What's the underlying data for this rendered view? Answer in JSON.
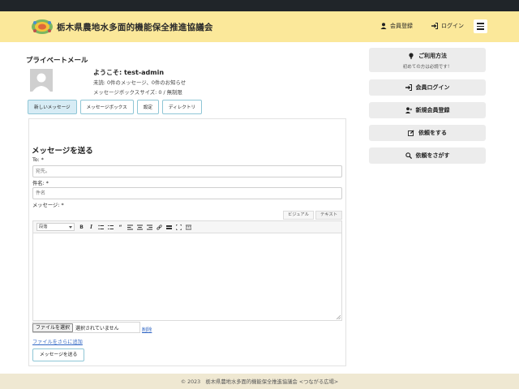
{
  "header": {
    "site_title": "栃木県農地水多面的機能保全推進協議会",
    "register_label": "会員登録",
    "login_label": "ログイン"
  },
  "main": {
    "page_heading": "プライベートメール",
    "welcome": "ようこそ: test-admin",
    "unread_info": "未読: 0件のメッセージ、0件のお知らせ",
    "box_size": "メッセージボックスサイズ: 0 / 無制限",
    "tabs": [
      {
        "label": "新しいメッセージ",
        "active": true
      },
      {
        "label": "メッセージボックス",
        "active": false
      },
      {
        "label": "設定",
        "active": false
      },
      {
        "label": "ディレクトリ",
        "active": false
      }
    ],
    "compose": {
      "title": "メッセージを送る",
      "to_label": "To: *",
      "to_placeholder": "宛先。",
      "subject_label": "件名: *",
      "subject_placeholder": "件名",
      "message_label": "メッセージ: *",
      "editor_tab_visual": "ビジュアル",
      "editor_tab_text": "テキスト",
      "format_select": "段落",
      "file_button": "ファイルを選択",
      "file_status": "選択されていません",
      "delete_link": "削除",
      "add_file_link": "ファイルをさらに追加",
      "send_button": "メッセージを送る"
    }
  },
  "sidebar": {
    "guide": {
      "label": "ご利用方法",
      "sub": "初めての方は必読です！"
    },
    "member_login": "会員ログイン",
    "new_register": "新規会員登録",
    "request": "依頼をする",
    "search_request": "依頼をさがす"
  },
  "footer": {
    "text": "© 2023　栃木県農地水多面的機能保全推進協議会 <つながる広場>"
  },
  "colors": {
    "header_bg": "#fbe89a",
    "topbar_bg": "#202529",
    "footer_bg": "#efe8d2",
    "button_border": "#8fc6d6",
    "link": "#3066c4"
  }
}
